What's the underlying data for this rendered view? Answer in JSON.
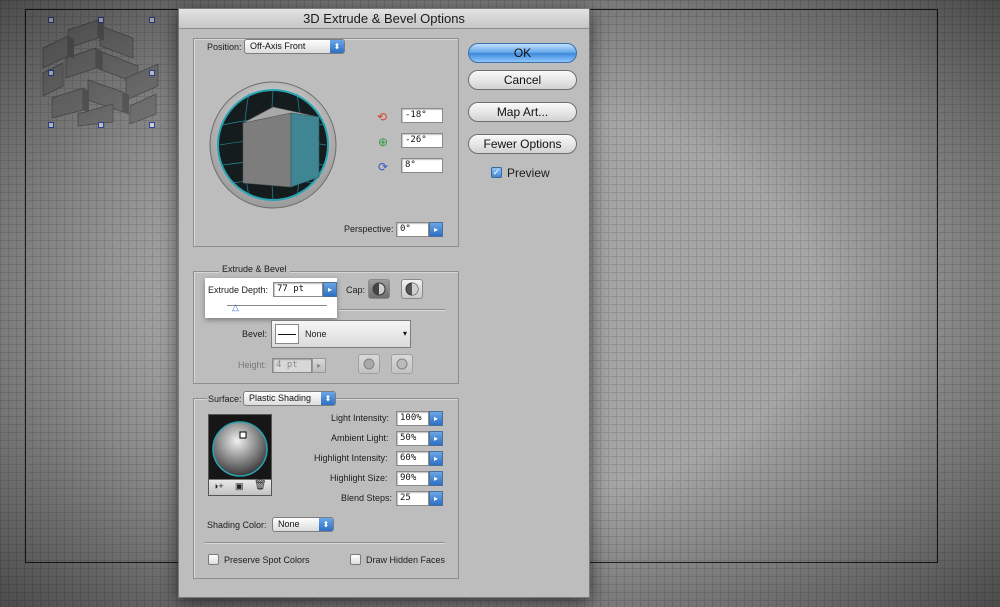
{
  "dialog": {
    "title": "3D Extrude & Bevel Options"
  },
  "position": {
    "label": "Position:",
    "preset": "Off-Axis Front",
    "rotate_x": "-18°",
    "rotate_y": "-26°",
    "rotate_z": "8°",
    "perspective_label": "Perspective:",
    "perspective": "0°"
  },
  "buttons": {
    "ok": "OK",
    "cancel": "Cancel",
    "map_art": "Map Art...",
    "fewer_options": "Fewer Options",
    "preview": "Preview"
  },
  "extrude": {
    "section_title": "Extrude & Bevel",
    "depth_label": "Extrude Depth:",
    "depth": "77 pt",
    "cap_label": "Cap:",
    "bevel_label": "Bevel:",
    "bevel": "None",
    "height_label": "Height:",
    "height": "4 pt"
  },
  "surface": {
    "label": "Surface:",
    "type": "Plastic Shading",
    "light_intensity_label": "Light Intensity:",
    "light_intensity": "100%",
    "ambient_light_label": "Ambient Light:",
    "ambient_light": "50%",
    "highlight_intensity_label": "Highlight Intensity:",
    "highlight_intensity": "60%",
    "highlight_size_label": "Highlight Size:",
    "highlight_size": "90%",
    "blend_steps_label": "Blend Steps:",
    "blend_steps": "25",
    "shading_color_label": "Shading Color:",
    "shading_color": "None",
    "preserve_spot_colors": "Preserve Spot Colors",
    "draw_hidden_faces": "Draw Hidden Faces"
  },
  "colors": {
    "cube_front": "#3f8594",
    "cube_side": "#7d7d7d",
    "track_ring": "#2aa3b3",
    "accent_blue": "#3b88da"
  },
  "icons": {
    "rotate_x": "rotate-x-axis-icon",
    "rotate_y": "rotate-y-axis-icon",
    "rotate_z": "rotate-z-axis-icon",
    "cap_on": "cap-on-icon",
    "cap_off": "cap-off-icon",
    "bevel_out": "bevel-out-icon",
    "bevel_in": "bevel-in-icon",
    "new_light": "new-light-icon",
    "move_light_back": "move-light-back-icon",
    "delete_light": "delete-light-icon"
  }
}
